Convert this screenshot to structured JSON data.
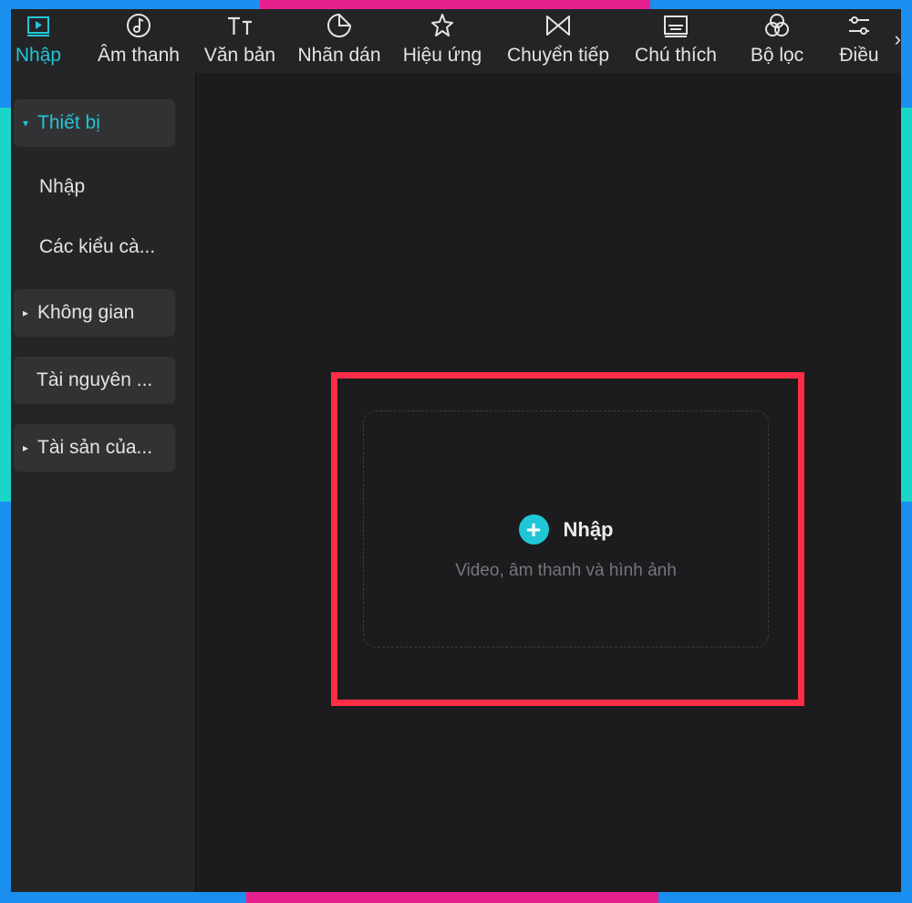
{
  "toolbar": {
    "tabs": [
      {
        "label": "Nhập",
        "icon": "media-play-icon",
        "active": true
      },
      {
        "label": "Âm thanh",
        "icon": "music-note-icon"
      },
      {
        "label": "Văn bản",
        "icon": "text-tt-icon"
      },
      {
        "label": "Nhãn dán",
        "icon": "sticker-icon"
      },
      {
        "label": "Hiệu ứng",
        "icon": "sparkle-star-icon"
      },
      {
        "label": "Chuyển tiếp",
        "icon": "transition-bowtie-icon"
      },
      {
        "label": "Chú thích",
        "icon": "caption-icon"
      },
      {
        "label": "Bộ lọc",
        "icon": "filter-circles-icon"
      },
      {
        "label": "Điều",
        "icon": "adjust-icon"
      }
    ],
    "overflow": "›"
  },
  "sidebar": {
    "items": [
      {
        "label": "Thiết bị",
        "marker": "▾"
      },
      {
        "label": "Nhập"
      },
      {
        "label": "Các kiểu cà..."
      },
      {
        "label": "Không gian",
        "marker": "▸"
      },
      {
        "label": "Tài nguyên ..."
      },
      {
        "label": "Tài sản của...",
        "marker": "▸"
      }
    ]
  },
  "main": {
    "import_label": "Nhập",
    "import_hint": "Video, âm thanh và hình ảnh",
    "plus": "+"
  },
  "colors": {
    "accent": "#20c6d6",
    "highlight": "#ff2d46",
    "frame_blue": "#1a8ff0",
    "frame_teal": "#1ad6c8",
    "frame_pink": "#e8208f"
  }
}
